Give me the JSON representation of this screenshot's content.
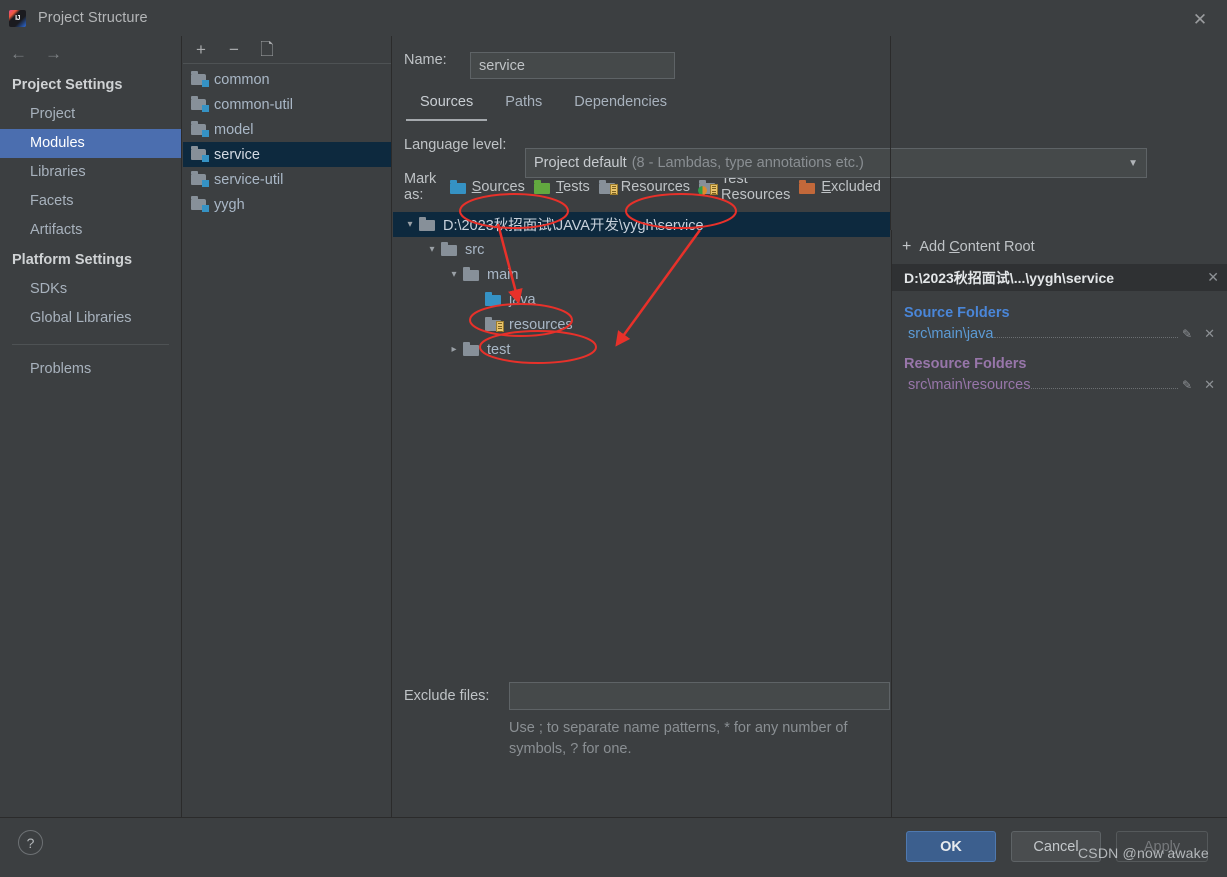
{
  "window": {
    "title": "Project Structure",
    "close_label": "✕",
    "logo_icon": "intellij-idea-logo"
  },
  "nav": {
    "back_icon": "arrow-left-icon",
    "forward_icon": "arrow-right-icon",
    "groups": [
      {
        "title": "Project Settings",
        "items": [
          {
            "label": "Project",
            "selected": false
          },
          {
            "label": "Modules",
            "selected": true
          },
          {
            "label": "Libraries",
            "selected": false
          },
          {
            "label": "Facets",
            "selected": false
          },
          {
            "label": "Artifacts",
            "selected": false
          }
        ]
      },
      {
        "title": "Platform Settings",
        "items": [
          {
            "label": "SDKs",
            "selected": false
          },
          {
            "label": "Global Libraries",
            "selected": false
          }
        ]
      }
    ],
    "problems_label": "Problems"
  },
  "modules": {
    "toolbar": {
      "add_icon": "plus-icon",
      "remove_icon": "minus-icon",
      "copy_icon": "copy-icon"
    },
    "items": [
      {
        "label": "common",
        "selected": false
      },
      {
        "label": "common-util",
        "selected": false
      },
      {
        "label": "model",
        "selected": false
      },
      {
        "label": "service",
        "selected": true
      },
      {
        "label": "service-util",
        "selected": false
      },
      {
        "label": "yygh",
        "selected": false
      }
    ]
  },
  "main": {
    "name_label": "Name:",
    "name_value": "service",
    "tabs": [
      {
        "label": "Sources",
        "active": true
      },
      {
        "label": "Paths",
        "active": false
      },
      {
        "label": "Dependencies",
        "active": false
      }
    ],
    "language_level": {
      "label": "Language level:",
      "value_strong": "Project default",
      "value_dim": "(8 - Lambdas, type annotations etc.)",
      "arrow_icon": "chevron-down-icon"
    },
    "mark_as": {
      "label": "Mark as:",
      "options": [
        {
          "label": "Sources",
          "mnemonic": "S",
          "icon": "sources-folder-icon",
          "color": "#3592c4"
        },
        {
          "label": "Tests",
          "mnemonic": "T",
          "icon": "tests-folder-icon",
          "color": "#62a93f"
        },
        {
          "label": "Resources",
          "mnemonic": "",
          "icon": "resources-folder-icon",
          "color": "#879099"
        },
        {
          "label": "Test Resources",
          "mnemonic": "",
          "icon": "test-resources-folder-icon",
          "color": "#879099"
        },
        {
          "label": "Excluded",
          "mnemonic": "E",
          "icon": "excluded-folder-icon",
          "color": "#c2683a"
        }
      ]
    },
    "tree": [
      {
        "label": "D:\\2023秋招面试\\JAVA开发\\yygh\\service",
        "indent": 0,
        "state": "open",
        "icon": "folder-icon",
        "kind": "plain",
        "selected": true
      },
      {
        "label": "src",
        "indent": 1,
        "state": "open",
        "icon": "folder-icon",
        "kind": "plain",
        "selected": false
      },
      {
        "label": "main",
        "indent": 2,
        "state": "open",
        "icon": "folder-icon",
        "kind": "plain",
        "selected": false
      },
      {
        "label": "java",
        "indent": 3,
        "state": "none",
        "icon": "sources-folder-icon",
        "kind": "sources",
        "selected": false
      },
      {
        "label": "resources",
        "indent": 3,
        "state": "none",
        "icon": "resources-folder-icon",
        "kind": "resources",
        "selected": false
      },
      {
        "label": "test",
        "indent": 2,
        "state": "closed",
        "icon": "folder-icon",
        "kind": "plain",
        "selected": false
      }
    ],
    "exclude": {
      "label": "Exclude files:",
      "value": "",
      "help": "Use ; to separate name patterns, * for any number of symbols, ? for one."
    }
  },
  "right_panel": {
    "add_content_root": "Add Content Root",
    "add_icon": "plus-icon",
    "root_path": "D:\\2023秋招面试\\...\\yygh\\service",
    "root_close_icon": "close-icon",
    "sections": [
      {
        "title": "Source Folders",
        "color": "#4a86d8",
        "kind": "src",
        "folders": [
          {
            "path": "src\\main\\java",
            "edit_icon": "pencil-icon",
            "remove_icon": "close-icon"
          }
        ]
      },
      {
        "title": "Resource Folders",
        "color": "#9876aa",
        "kind": "res",
        "folders": [
          {
            "path": "src\\main\\resources",
            "edit_icon": "pencil-icon",
            "remove_icon": "close-icon"
          }
        ]
      }
    ]
  },
  "footer": {
    "help_icon": "question-mark-icon",
    "ok_label": "OK",
    "cancel_label": "Cancel",
    "apply_label": "Apply",
    "watermark": "CSDN @now awake"
  },
  "annotations": {
    "color": "#e8312a",
    "shapes": [
      {
        "type": "ellipse",
        "target": "sources-mark-option"
      },
      {
        "type": "ellipse",
        "target": "resources-mark-option"
      },
      {
        "type": "ellipse",
        "target": "java-tree-node"
      },
      {
        "type": "ellipse",
        "target": "resources-tree-node"
      },
      {
        "type": "arrow",
        "from": "sources-mark-option",
        "to": "java-tree-node"
      },
      {
        "type": "arrow",
        "from": "resources-mark-option",
        "to": "resources-tree-node"
      }
    ]
  }
}
